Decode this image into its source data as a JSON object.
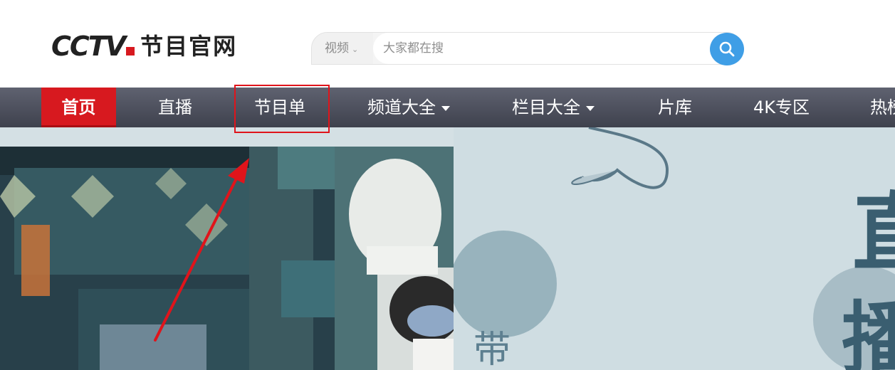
{
  "header": {
    "logo_text": "CCTV",
    "logo_sub": "节目官网"
  },
  "search": {
    "category": "视频",
    "placeholder": "大家都在搜"
  },
  "nav": {
    "items": [
      {
        "label": "首页",
        "active": true
      },
      {
        "label": "直播"
      },
      {
        "label": "节目单"
      },
      {
        "label": "频道大全",
        "dropdown": true
      },
      {
        "label": "栏目大全",
        "dropdown": true
      },
      {
        "label": "片库"
      },
      {
        "label": "4K专区"
      },
      {
        "label": "热榜"
      }
    ]
  },
  "banner": {
    "art_chars": [
      "带",
      "直",
      "播"
    ]
  },
  "colors": {
    "accent_red": "#d7191f",
    "nav_bg": "#4a4d59",
    "search_blue": "#3f9ee6",
    "banner_bg": "#d4e0e4",
    "annotation_red": "#e0141b"
  }
}
